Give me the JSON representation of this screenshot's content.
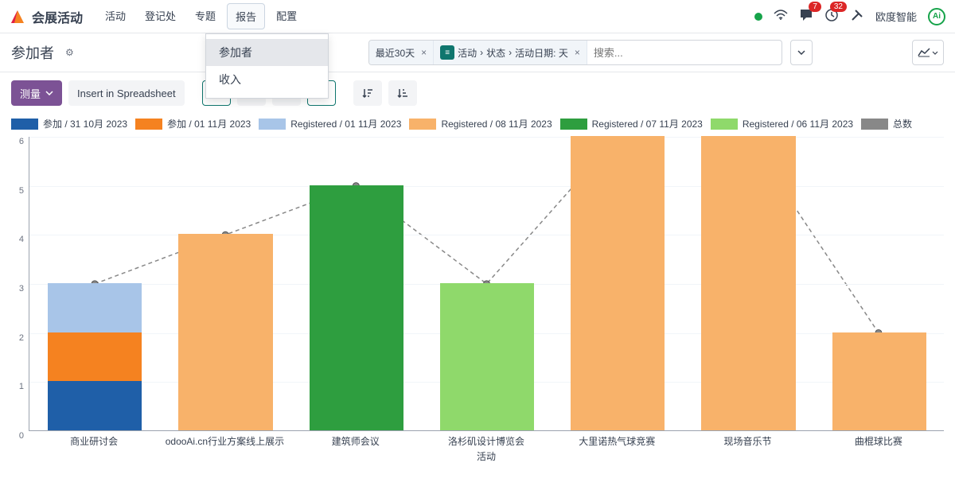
{
  "app_title": "会展活动",
  "nav": [
    "活动",
    "登记处",
    "专题",
    "报告",
    "配置"
  ],
  "nav_active_index": 3,
  "dropdown": {
    "items": [
      "参加者",
      "收入"
    ],
    "hover_index": 0
  },
  "notifications": {
    "chat": 7,
    "clock": 32
  },
  "user": "欧度智能",
  "page_title": "参加者",
  "filter1": {
    "label": "最近30天"
  },
  "filter2": {
    "parts": [
      "活动",
      "状态",
      "活动日期: 天"
    ]
  },
  "search_placeholder": "搜索...",
  "toolbar": {
    "measure": "测量",
    "insert": "Insert in Spreadsheet"
  },
  "legend": [
    {
      "label": "参加 / 31 10月 2023",
      "color": "#1f5fa8"
    },
    {
      "label": "参加 / 01 11月 2023",
      "color": "#f58220"
    },
    {
      "label": "Registered / 01 11月 2023",
      "color": "#a8c5e8"
    },
    {
      "label": "Registered / 08 11月 2023",
      "color": "#f8b26a"
    },
    {
      "label": "Registered / 07 11月 2023",
      "color": "#2e9e3f"
    },
    {
      "label": "Registered / 06 11月 2023",
      "color": "#8fd96b"
    },
    {
      "label": "总数",
      "color": "#888888"
    }
  ],
  "chart_data": {
    "type": "bar",
    "ylim": [
      0,
      6
    ],
    "categories": [
      "商业研讨会",
      "odooAi.cn行业方案线上展示",
      "建筑师会议",
      "洛杉矶设计博览会",
      "大里诺热气球竞赛",
      "现场音乐节",
      "曲棍球比赛"
    ],
    "xlabel": "活动",
    "series_bars": [
      {
        "category": "商业研讨会",
        "stacks": [
          {
            "series": "参加 / 31 10月 2023",
            "value": 1,
            "color": "#1f5fa8"
          },
          {
            "series": "参加 / 01 11月 2023",
            "value": 1,
            "color": "#f58220"
          },
          {
            "series": "Registered / 01 11月 2023",
            "value": 1,
            "color": "#a8c5e8"
          }
        ],
        "total": 3
      },
      {
        "category": "odooAi.cn行业方案线上展示",
        "stacks": [
          {
            "series": "Registered / 08 11月 2023",
            "value": 4,
            "color": "#f8b26a"
          }
        ],
        "total": 4
      },
      {
        "category": "建筑师会议",
        "stacks": [
          {
            "series": "Registered / 07 11月 2023",
            "value": 5,
            "color": "#2e9e3f"
          }
        ],
        "total": 5
      },
      {
        "category": "洛杉矶设计博览会",
        "stacks": [
          {
            "series": "Registered / 06 11月 2023",
            "value": 3,
            "color": "#8fd96b"
          }
        ],
        "total": 3
      },
      {
        "category": "大里诺热气球竞赛",
        "stacks": [
          {
            "series": "Registered / 08 11月 2023",
            "value": 6,
            "color": "#f8b26a"
          }
        ],
        "total": 6
      },
      {
        "category": "现场音乐节",
        "stacks": [
          {
            "series": "Registered / 08 11月 2023",
            "value": 6,
            "color": "#f8b26a"
          }
        ],
        "total": 6
      },
      {
        "category": "曲棍球比赛",
        "stacks": [
          {
            "series": "Registered / 08 11月 2023",
            "value": 2,
            "color": "#f8b26a"
          }
        ],
        "total": 2
      }
    ],
    "line_totals": [
      3,
      4,
      5,
      3,
      6,
      6,
      2
    ]
  }
}
